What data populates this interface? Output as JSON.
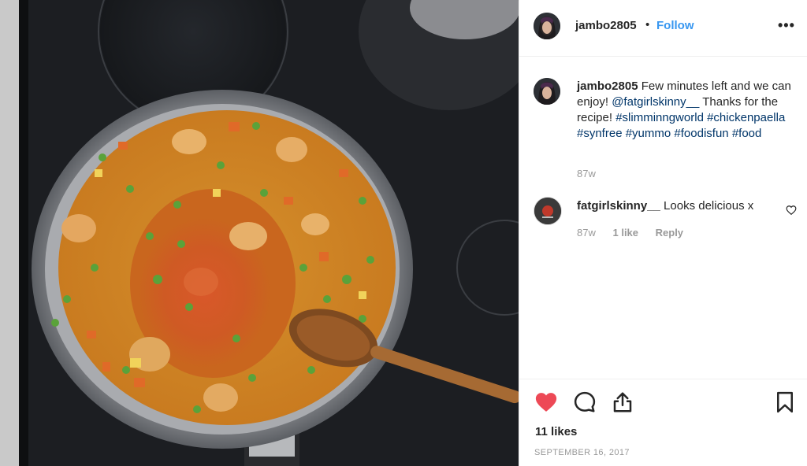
{
  "post": {
    "author": "jambo2805",
    "separator": "•",
    "follow_label": "Follow",
    "more_label": "•••",
    "caption": {
      "author": "jambo2805",
      "text": "Few minutes left and we can enjoy!",
      "mention": "@fatgirlskinny__",
      "text_after": "Thanks for the recipe!",
      "hashtags": [
        "#slimminngworld",
        "#chickenpaella",
        "#synfree",
        "#yummo",
        "#foodisfun",
        "#food"
      ],
      "time": "87w"
    },
    "comments": [
      {
        "author": "fatgirlskinny__",
        "text": "Looks delicious x",
        "time": "87w",
        "likes": "1 like",
        "reply_label": "Reply"
      }
    ],
    "likes": "11 likes",
    "date": "SEPTEMBER 16, 2017"
  },
  "icons": {
    "like": "heart-filled-icon",
    "comment": "comment-bubble-icon",
    "share": "share-upload-icon",
    "save": "bookmark-icon",
    "more": "more-options-icon",
    "comment_like": "heart-outline-icon"
  },
  "colors": {
    "accent": "#3897f0",
    "hashtag": "#003569",
    "like_red": "#ed4956",
    "muted": "#999999"
  }
}
